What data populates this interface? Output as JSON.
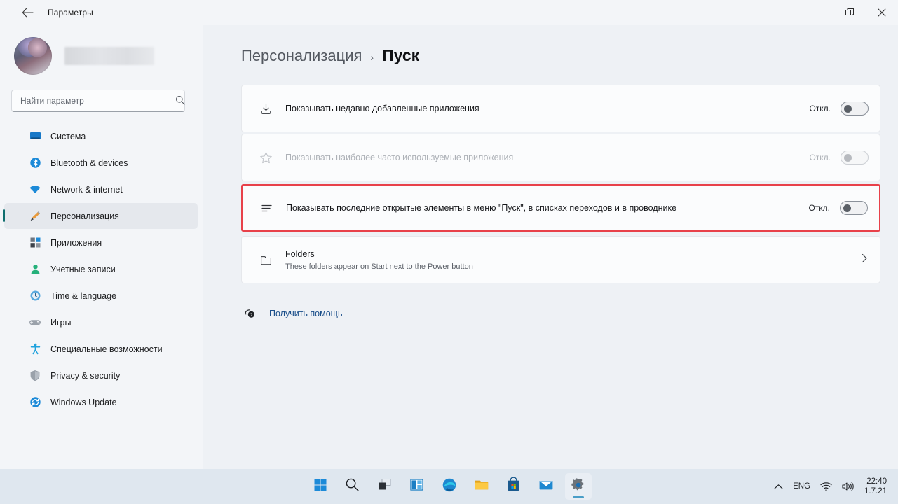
{
  "window": {
    "title": "Параметры",
    "back_icon": "arrow-left-icon",
    "controls": {
      "minimize": "minimize-icon",
      "restore": "restore-icon",
      "close": "close-icon"
    }
  },
  "sidebar": {
    "profile": {
      "avatar": "user-avatar",
      "name": ""
    },
    "search": {
      "placeholder": "Найти параметр",
      "value": "",
      "icon": "search-icon"
    },
    "items": [
      {
        "label": "Система",
        "icon": "monitor-icon",
        "selected": false
      },
      {
        "label": "Bluetooth & devices",
        "icon": "bluetooth-icon",
        "selected": false
      },
      {
        "label": "Network & internet",
        "icon": "wifi-icon",
        "selected": false
      },
      {
        "label": "Персонализация",
        "icon": "paintbrush-icon",
        "selected": true
      },
      {
        "label": "Приложения",
        "icon": "apps-icon",
        "selected": false
      },
      {
        "label": "Учетные записи",
        "icon": "person-icon",
        "selected": false
      },
      {
        "label": "Time & language",
        "icon": "clock-icon",
        "selected": false
      },
      {
        "label": "Игры",
        "icon": "gamepad-icon",
        "selected": false
      },
      {
        "label": "Специальные возможности",
        "icon": "accessibility-icon",
        "selected": false
      },
      {
        "label": "Privacy & security",
        "icon": "shield-icon",
        "selected": false
      },
      {
        "label": "Windows Update",
        "icon": "update-icon",
        "selected": false
      }
    ]
  },
  "main": {
    "breadcrumb": {
      "parent": "Персонализация",
      "separator": "›",
      "current": "Пуск"
    },
    "rows": [
      {
        "label": "Показывать недавно добавленные приложения",
        "icon": "download-icon",
        "toggle_label": "Откл.",
        "toggle_on": false,
        "disabled": false,
        "highlighted": false
      },
      {
        "label": "Показывать наиболее часто используемые приложения",
        "icon": "star-icon",
        "toggle_label": "Откл.",
        "toggle_on": false,
        "disabled": true,
        "highlighted": false
      },
      {
        "label": "Показывать последние открытые элементы в меню \"Пуск\", в списках переходов и в проводнике",
        "icon": "list-icon",
        "toggle_label": "Откл.",
        "toggle_on": false,
        "disabled": false,
        "highlighted": true
      }
    ],
    "folders_row": {
      "title": "Folders",
      "subtitle": "These folders appear on Start next to the Power button",
      "icon": "folder-icon",
      "chevron": "chevron-right-icon"
    },
    "help": {
      "label": "Получить помощь",
      "icon": "help-question-icon"
    }
  },
  "taskbar": {
    "buttons": [
      {
        "name": "start",
        "icon": "windows-logo-icon",
        "active": false
      },
      {
        "name": "search",
        "icon": "search-icon",
        "active": false
      },
      {
        "name": "task-view",
        "icon": "task-view-icon",
        "active": false
      },
      {
        "name": "widgets",
        "icon": "widgets-icon",
        "active": false
      },
      {
        "name": "edge",
        "icon": "edge-icon",
        "active": false
      },
      {
        "name": "file-explorer",
        "icon": "folder-icon",
        "active": false
      },
      {
        "name": "microsoft-store",
        "icon": "store-icon",
        "active": false
      },
      {
        "name": "mail",
        "icon": "mail-icon",
        "active": false
      },
      {
        "name": "settings",
        "icon": "gear-icon",
        "active": true
      }
    ],
    "tray": {
      "overflow_icon": "chevron-up-icon",
      "language": "ENG",
      "network_icon": "wifi-icon",
      "volume_icon": "speaker-icon",
      "time": "22:40",
      "date": "1.7.21"
    }
  },
  "colors": {
    "accent_selected": "#0f6e6e",
    "highlight_border": "#e8414a",
    "link": "#1b4f8a",
    "taskbar_bg": "#dfe7ef",
    "page_bg": "#eef1f5"
  }
}
